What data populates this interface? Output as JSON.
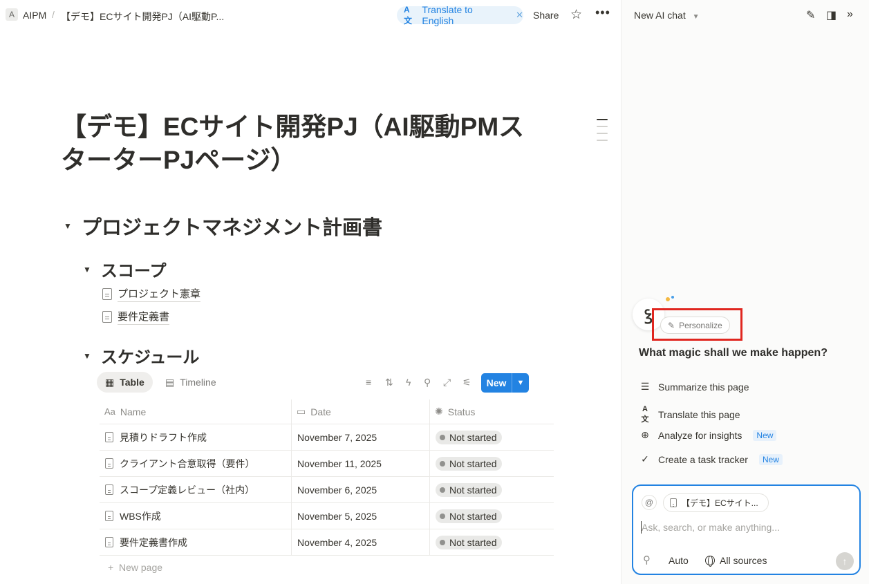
{
  "breadcrumb": {
    "workspace_initial": "A",
    "workspace": "AIPM",
    "separator": "/",
    "page": "【デモ】ECサイト開発PJ（AI駆動P..."
  },
  "topbar": {
    "translate_label": "Translate to English",
    "share_label": "Share"
  },
  "page": {
    "title": "【デモ】ECサイト開発PJ（AI駆動PMスターターPJページ）",
    "heading1": "プロジェクトマネジメント計画書",
    "scope_heading": "スコープ",
    "scope_links": [
      "プロジェクト憲章",
      "要件定義書"
    ],
    "schedule_heading": "スケジュール"
  },
  "database": {
    "views": [
      {
        "label": "Table",
        "icon": "table-icon",
        "active": true
      },
      {
        "label": "Timeline",
        "icon": "timeline-icon",
        "active": false
      }
    ],
    "new_label": "New",
    "columns": [
      {
        "label": "Name",
        "icon": "text-property-icon"
      },
      {
        "label": "Date",
        "icon": "calendar-icon"
      },
      {
        "label": "Status",
        "icon": "status-icon"
      }
    ],
    "rows": [
      {
        "name": "見積りドラフト作成",
        "date": "November 7, 2025",
        "status": "Not started"
      },
      {
        "name": "クライアント合意取得（要件）",
        "date": "November 11, 2025",
        "status": "Not started"
      },
      {
        "name": "スコープ定義レビュー（社内）",
        "date": "November 6, 2025",
        "status": "Not started"
      },
      {
        "name": "WBS作成",
        "date": "November 5, 2025",
        "status": "Not started"
      },
      {
        "name": "要件定義書作成",
        "date": "November 4, 2025",
        "status": "Not started"
      }
    ],
    "new_page_label": "New page"
  },
  "ai_panel": {
    "title": "New AI chat",
    "personalize_label": "Personalize",
    "prompt_heading": "What magic shall we make happen?",
    "suggestions": [
      {
        "label": "Summarize this page",
        "icon": "lines-icon",
        "badge": ""
      },
      {
        "label": "Translate this page",
        "icon": "translate-icon",
        "badge": ""
      },
      {
        "label": "Analyze for insights",
        "icon": "zoom-icon",
        "badge": "New"
      },
      {
        "label": "Create a task tracker",
        "icon": "check-circle-icon",
        "badge": "New"
      }
    ],
    "composer": {
      "context_chip": "【デモ】ECサイト...",
      "placeholder": "Ask, search, or make anything...",
      "mode": "Auto",
      "sources": "All sources"
    }
  },
  "colors": {
    "accent": "#2383e2",
    "highlight_box": "#e0261f",
    "status_bg": "#e9e9e7"
  }
}
